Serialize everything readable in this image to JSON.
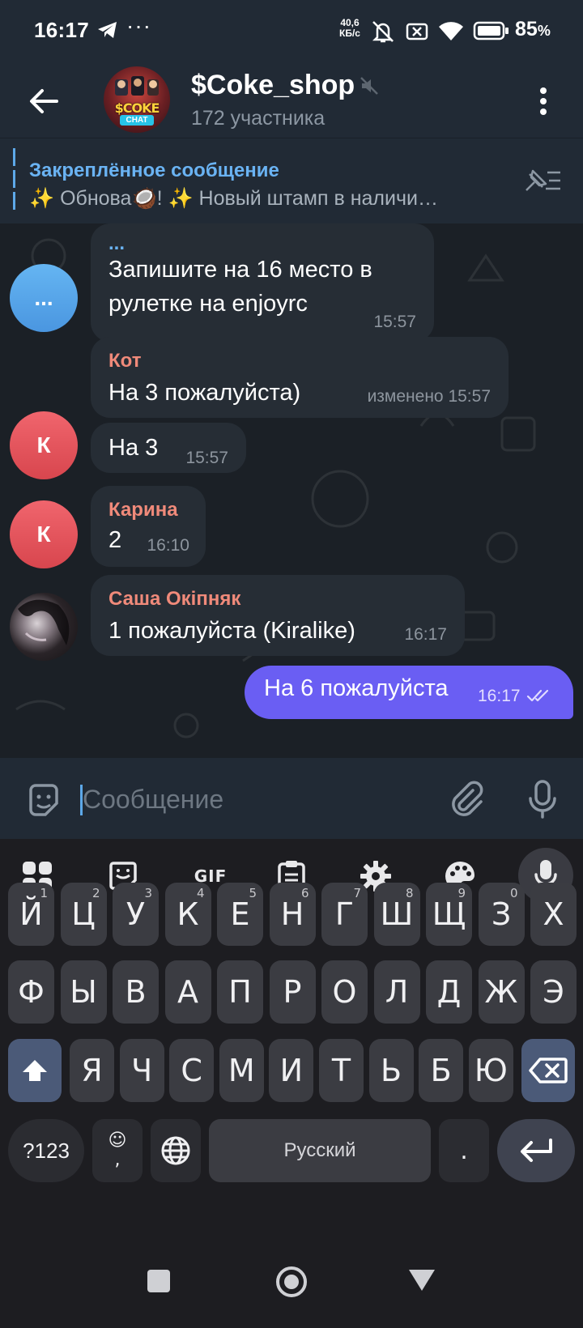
{
  "status_bar": {
    "time": "16:17",
    "dots": "···",
    "net_speed_value": "40,6",
    "net_speed_unit": "КБ/с",
    "battery": "85",
    "battery_unit": "%"
  },
  "header": {
    "title": "$Coke_shop",
    "subtitle": "172 участника",
    "avatar_text_1": "$COKE",
    "avatar_text_2": "CHAT"
  },
  "pinned": {
    "title": "Закреплённое сообщение",
    "text": "✨ Обнова🥥! ✨ Новый штамп в наличи…"
  },
  "messages": [
    {
      "avatar": "...",
      "name": "...",
      "text_line1": "Запишите на 16 место в",
      "text_line2": "рулетке на enjoyrc",
      "time": "15:57"
    },
    {
      "name": "Кот",
      "text": "На 3 пожалуйста)",
      "meta": "изменено 15:57"
    },
    {
      "avatar": "К",
      "text": "На 3",
      "time": "15:57"
    },
    {
      "avatar": "К",
      "name": "Карина",
      "text": "2",
      "time": "16:10"
    },
    {
      "name": "Саша Окіпняк",
      "text": "1 пожалуйста (Kiralike)",
      "time": "16:17"
    },
    {
      "outgoing": true,
      "text": "На 6 пожалуйста",
      "time": "16:17"
    }
  ],
  "input": {
    "placeholder": "Сообщение"
  },
  "keyboard": {
    "gif_label": "GIF",
    "row1": [
      {
        "k": "Й",
        "h": "1"
      },
      {
        "k": "Ц",
        "h": "2"
      },
      {
        "k": "У",
        "h": "3"
      },
      {
        "k": "К",
        "h": "4"
      },
      {
        "k": "Е",
        "h": "5"
      },
      {
        "k": "Н",
        "h": "6"
      },
      {
        "k": "Г",
        "h": "7"
      },
      {
        "k": "Ш",
        "h": "8"
      },
      {
        "k": "Щ",
        "h": "9"
      },
      {
        "k": "З",
        "h": "0"
      },
      {
        "k": "Х",
        "h": ""
      }
    ],
    "row2": [
      "Ф",
      "Ы",
      "В",
      "А",
      "П",
      "Р",
      "О",
      "Л",
      "Д",
      "Ж",
      "Э"
    ],
    "row3": [
      "Я",
      "Ч",
      "С",
      "М",
      "И",
      "Т",
      "Ь",
      "Б",
      "Ю"
    ],
    "sym_label": "?123",
    "emoji_comma_top": "☺",
    "emoji_comma_bottom": ",",
    "space_label": "Русский",
    "period_label": "."
  },
  "colors": {
    "accent": "#6ab3f3",
    "outgoing_bubble": "#6a5ef3",
    "name_kot": "#f08a7a",
    "name_karina": "#f08a7a",
    "name_sasha": "#f08a7a",
    "name_dots": "#6ab3f3"
  }
}
